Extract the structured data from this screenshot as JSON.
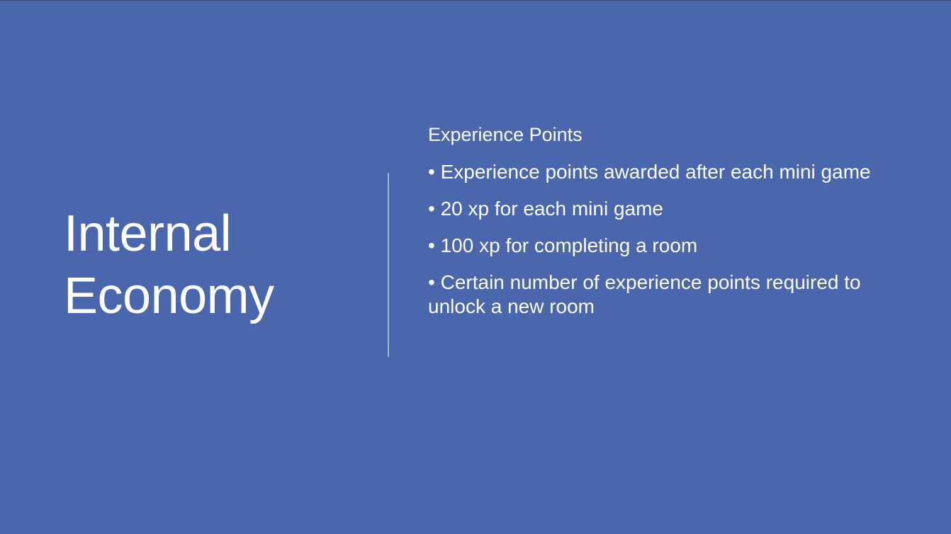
{
  "slide": {
    "title_lines": [
      "Internal",
      "Economy"
    ],
    "heading": "Experience Points",
    "bullet_char": "•",
    "bullets": [
      "Experience points awarded after each mini game",
      "20 xp for each mini game",
      "100 xp for completing a room",
      "Certain number of experience points required to unlock a new room"
    ]
  },
  "colors": {
    "background": "#4a66ad",
    "text": "#ffffff",
    "divider": "#aab6d6"
  }
}
